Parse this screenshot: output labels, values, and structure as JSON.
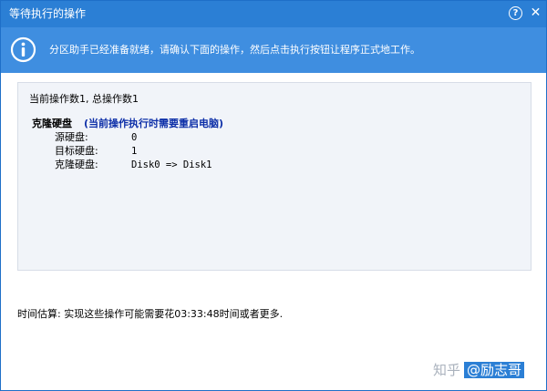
{
  "window": {
    "title": "等待执行的操作",
    "help_symbol": "?",
    "close_symbol": "✕",
    "titlebar_color": "#2b7fd5",
    "banner_color": "#3f8ee0"
  },
  "banner": {
    "icon": "info-icon",
    "text": "分区助手已经准备就绪，请确认下面的操作，然后点击执行按钮让程序正式地工作。"
  },
  "operations": {
    "summary": "当前操作数1, 总操作数1",
    "items": [
      {
        "name": "克隆硬盘",
        "note": "(当前操作执行时需要重启电脑)",
        "note_color": "#0d2fa8",
        "details": [
          {
            "label": "源硬盘:",
            "value": "0"
          },
          {
            "label": "目标硬盘:",
            "value": "1"
          },
          {
            "label": "克隆硬盘:",
            "value": "Disk0 => Disk1"
          }
        ]
      }
    ]
  },
  "estimate": "时间估算: 实现这些操作可能需要花03:33:48时间或者更多.",
  "watermark": {
    "site": "知乎",
    "handle": "@励志哥"
  }
}
